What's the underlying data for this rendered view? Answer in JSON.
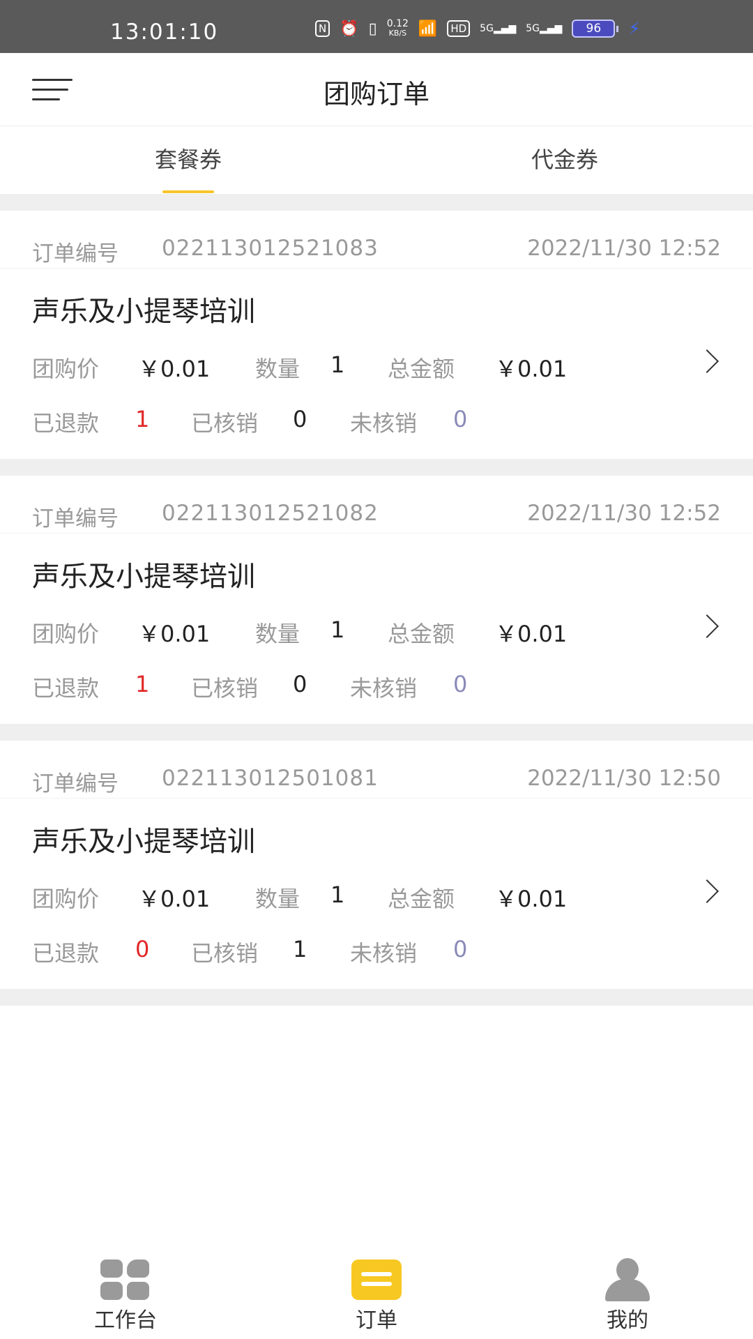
{
  "status_bar": {
    "time": "13:01:10",
    "net_speed": "0.12",
    "net_unit": "KB/S",
    "hd": "HD",
    "signal_1": "5G",
    "signal_2": "5G",
    "battery": "96"
  },
  "header": {
    "title": "团购订单"
  },
  "tabs": [
    {
      "label": "套餐券",
      "active": true
    },
    {
      "label": "代金券",
      "active": false
    }
  ],
  "orders": [
    {
      "id_label": "订单编号",
      "id": "022113012521083",
      "date": "2022/11/30 12:52",
      "name": "声乐及小提琴培训",
      "price_label": "团购价",
      "price": "￥0.01",
      "qty_label": "数量",
      "qty": "1",
      "total_label": "总金额",
      "total": "￥0.01",
      "refunded_label": "已退款",
      "refunded": "1",
      "verified_label": "已核销",
      "verified": "0",
      "unverified_label": "未核销",
      "unverified": "0"
    },
    {
      "id_label": "订单编号",
      "id": "022113012521082",
      "date": "2022/11/30 12:52",
      "name": "声乐及小提琴培训",
      "price_label": "团购价",
      "price": "￥0.01",
      "qty_label": "数量",
      "qty": "1",
      "total_label": "总金额",
      "total": "￥0.01",
      "refunded_label": "已退款",
      "refunded": "1",
      "verified_label": "已核销",
      "verified": "0",
      "unverified_label": "未核销",
      "unverified": "0"
    },
    {
      "id_label": "订单编号",
      "id": "022113012501081",
      "date": "2022/11/30 12:50",
      "name": "声乐及小提琴培训",
      "price_label": "团购价",
      "price": "￥0.01",
      "qty_label": "数量",
      "qty": "1",
      "total_label": "总金额",
      "total": "￥0.01",
      "refunded_label": "已退款",
      "refunded": "0",
      "verified_label": "已核销",
      "verified": "1",
      "unverified_label": "未核销",
      "unverified": "0"
    }
  ],
  "bottom_nav": [
    {
      "label": "工作台",
      "icon": "workbench-icon"
    },
    {
      "label": "订单",
      "icon": "order-icon",
      "active": true
    },
    {
      "label": "我的",
      "icon": "profile-icon"
    }
  ],
  "colors": {
    "accent": "#f8c822",
    "refund_red": "#e12727",
    "unverified": "#8a8ab8"
  }
}
